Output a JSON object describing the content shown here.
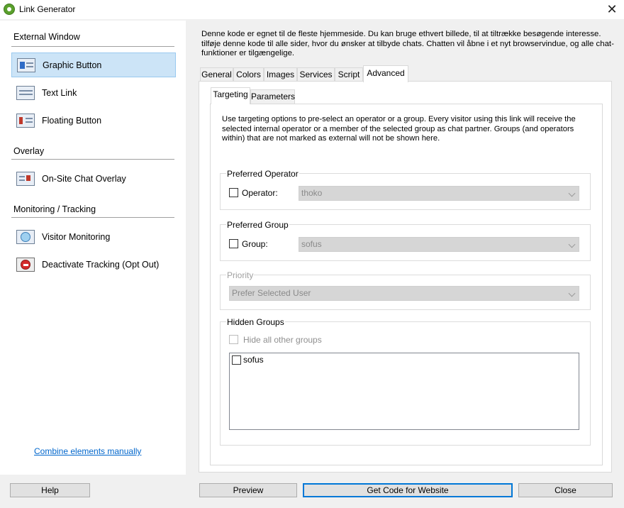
{
  "window": {
    "title": "Link Generator",
    "close_glyph": "✕"
  },
  "sidebar": {
    "sections": [
      {
        "title": "External Window"
      },
      {
        "title": "Overlay"
      },
      {
        "title": "Monitoring / Tracking"
      }
    ],
    "items": [
      {
        "label": "Graphic Button",
        "icon": "graphic-button-icon",
        "selected": true
      },
      {
        "label": "Text Link",
        "icon": "text-link-icon"
      },
      {
        "label": "Floating Button",
        "icon": "floating-button-icon"
      },
      {
        "label": "On-Site Chat Overlay",
        "icon": "chat-overlay-icon"
      },
      {
        "label": "Visitor Monitoring",
        "icon": "visitor-monitoring-icon"
      },
      {
        "label": "Deactivate Tracking (Opt Out)",
        "icon": "deactivate-tracking-icon"
      }
    ],
    "combine_link": "Combine elements manually"
  },
  "description": "Denne kode er egnet til de fleste hjemmeside. Du kan bruge ethvert billede, til at tiltrække besøgende interesse. tilføje denne kode til alle sider, hvor du ønsker at tilbyde chats. Chatten vil åbne i et nyt browservindue, og alle chat-funktioner er tilgængelige.",
  "tabs": [
    {
      "label": "General"
    },
    {
      "label": "Colors"
    },
    {
      "label": "Images"
    },
    {
      "label": "Services"
    },
    {
      "label": "Script"
    },
    {
      "label": "Advanced",
      "active": true
    }
  ],
  "subtabs": [
    {
      "label": "Targeting",
      "active": true
    },
    {
      "label": "Parameters"
    }
  ],
  "targeting": {
    "info": "Use targeting options to pre-select an operator or a group. Every visitor using this link will receive the selected internal operator or a member of the selected group as chat partner. Groups (and operators within) that are not marked as external will not be shown here.",
    "preferred_operator": {
      "legend": "Preferred Operator",
      "checkbox_label": "Operator:",
      "checked": false,
      "value": "thoko"
    },
    "preferred_group": {
      "legend": "Preferred Group",
      "checkbox_label": "Group:",
      "checked": false,
      "value": "sofus"
    },
    "priority": {
      "legend": "Priority",
      "value": "Prefer Selected User",
      "enabled": false
    },
    "hidden_groups": {
      "legend": "Hidden Groups",
      "hide_all_label": "Hide all other groups",
      "items": [
        {
          "label": "sofus",
          "checked": false
        }
      ]
    }
  },
  "buttons": {
    "help": "Help",
    "preview": "Preview",
    "get_code": "Get Code for Website",
    "close": "Close"
  }
}
